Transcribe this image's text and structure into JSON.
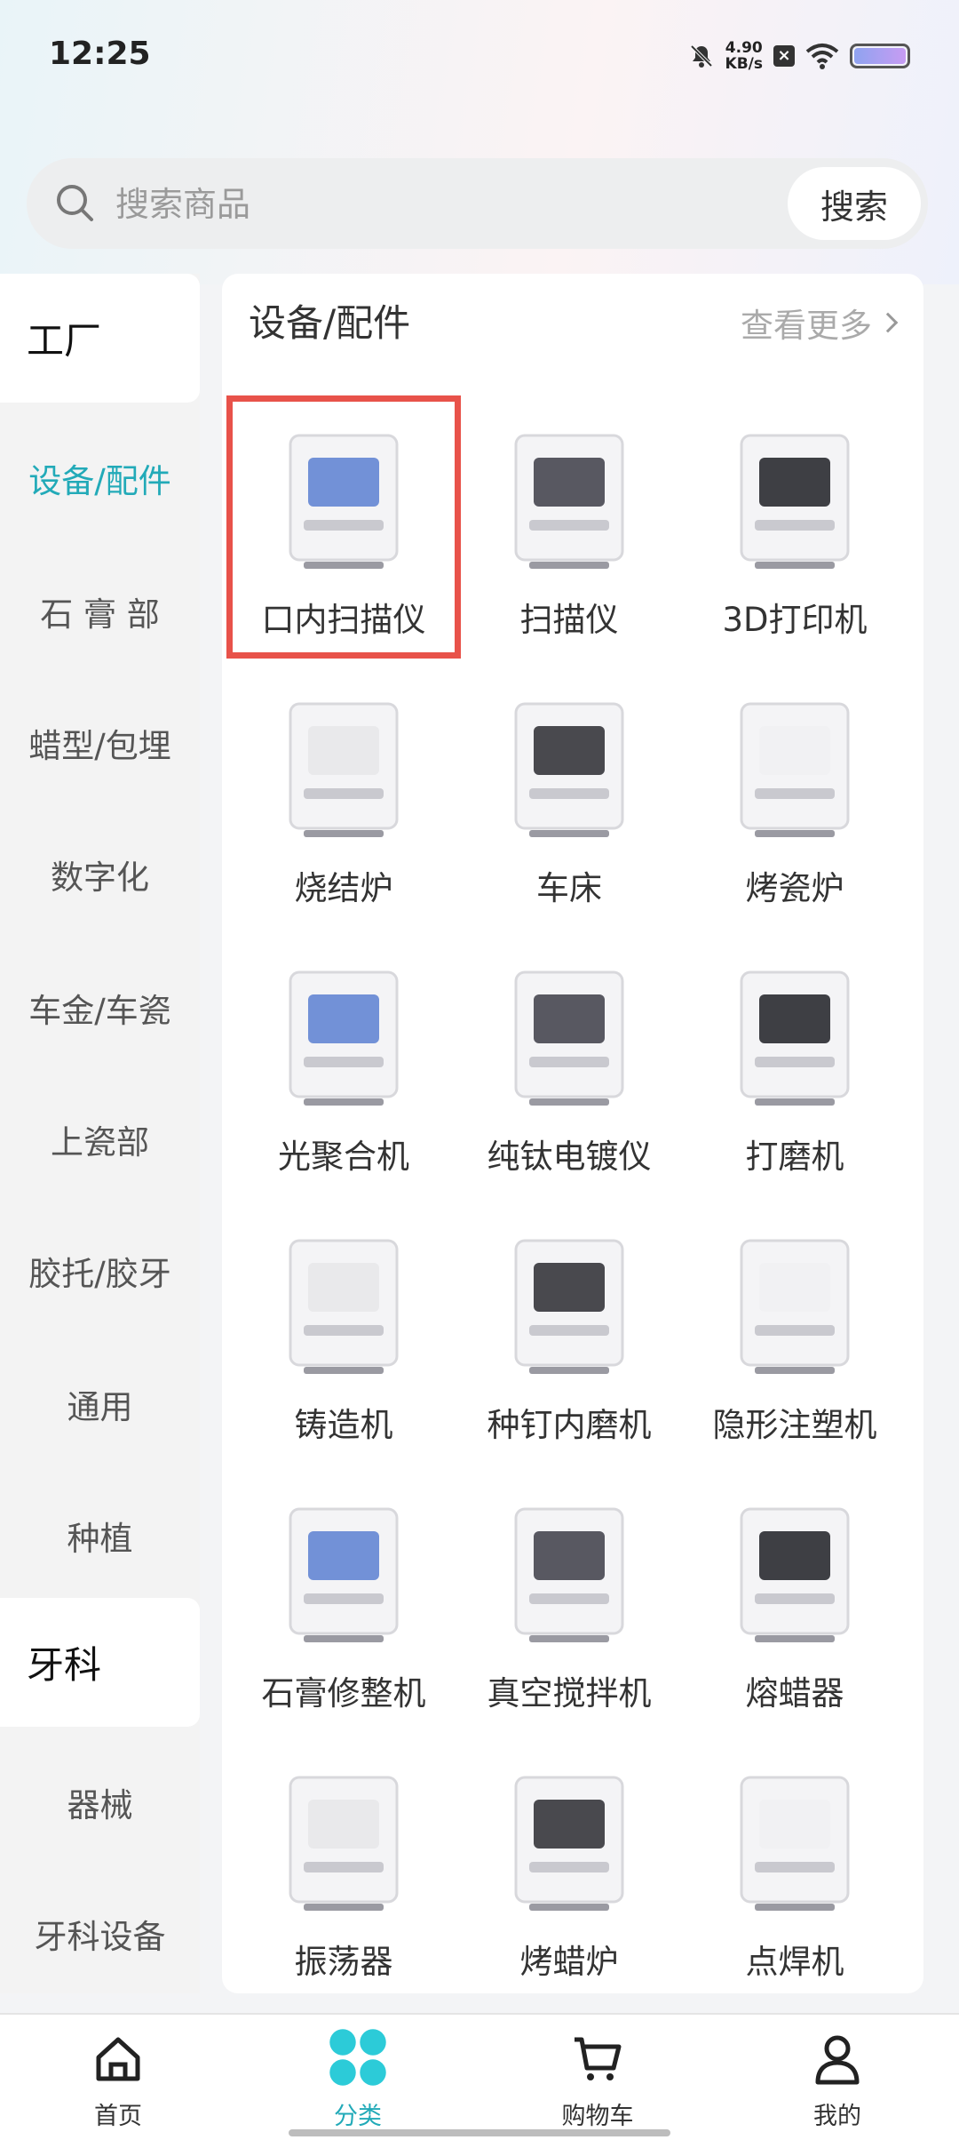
{
  "status": {
    "time": "12:25",
    "speed_value": "4.90",
    "speed_unit": "KB/s"
  },
  "search": {
    "placeholder": "搜索商品",
    "button": "搜索"
  },
  "sidebar": {
    "groups": [
      {
        "label": "工厂"
      },
      {
        "label": "牙科"
      }
    ],
    "items": [
      {
        "label": "设备/配件",
        "active": true
      },
      {
        "label": "石 膏 部"
      },
      {
        "label": "蜡型/包埋"
      },
      {
        "label": "数字化"
      },
      {
        "label": "车金/车瓷"
      },
      {
        "label": "上瓷部"
      },
      {
        "label": "胶托/胶牙"
      },
      {
        "label": "通用"
      },
      {
        "label": "种植"
      },
      {
        "label": "器械"
      },
      {
        "label": "牙科设备"
      }
    ]
  },
  "section": {
    "title": "设备/配件",
    "see_more": "查看更多"
  },
  "products": [
    {
      "label": "口内扫描仪",
      "icon": "intraoral-scanner",
      "highlighted": true
    },
    {
      "label": "扫描仪",
      "icon": "scanner"
    },
    {
      "label": "3D打印机",
      "icon": "3d-printer"
    },
    {
      "label": "烧结炉",
      "icon": "sintering-furnace"
    },
    {
      "label": "车床",
      "icon": "milling-machine"
    },
    {
      "label": "烤瓷炉",
      "icon": "porcelain-furnace"
    },
    {
      "label": "光聚合机",
      "icon": "light-curing-unit"
    },
    {
      "label": "纯钛电镀仪",
      "icon": "electroplating-unit"
    },
    {
      "label": "打磨机",
      "icon": "polishing-motor"
    },
    {
      "label": "铸造机",
      "icon": "casting-machine"
    },
    {
      "label": "种钉内磨机",
      "icon": "implant-grinder"
    },
    {
      "label": "隐形注塑机",
      "icon": "injection-molder"
    },
    {
      "label": "石膏修整机",
      "icon": "plaster-trimmer"
    },
    {
      "label": "真空搅拌机",
      "icon": "vacuum-mixer"
    },
    {
      "label": "熔蜡器",
      "icon": "wax-melter"
    },
    {
      "label": "振荡器",
      "icon": "vibrator"
    },
    {
      "label": "烤蜡炉",
      "icon": "burnout-furnace"
    },
    {
      "label": "点焊机",
      "icon": "spot-welder"
    }
  ],
  "nav": [
    {
      "label": "首页",
      "icon": "home-icon"
    },
    {
      "label": "分类",
      "icon": "category-icon",
      "active": true
    },
    {
      "label": "购物车",
      "icon": "cart-icon"
    },
    {
      "label": "我的",
      "icon": "profile-icon"
    }
  ],
  "colors": {
    "accent": "#22aab8",
    "highlight": "#e8524a"
  }
}
